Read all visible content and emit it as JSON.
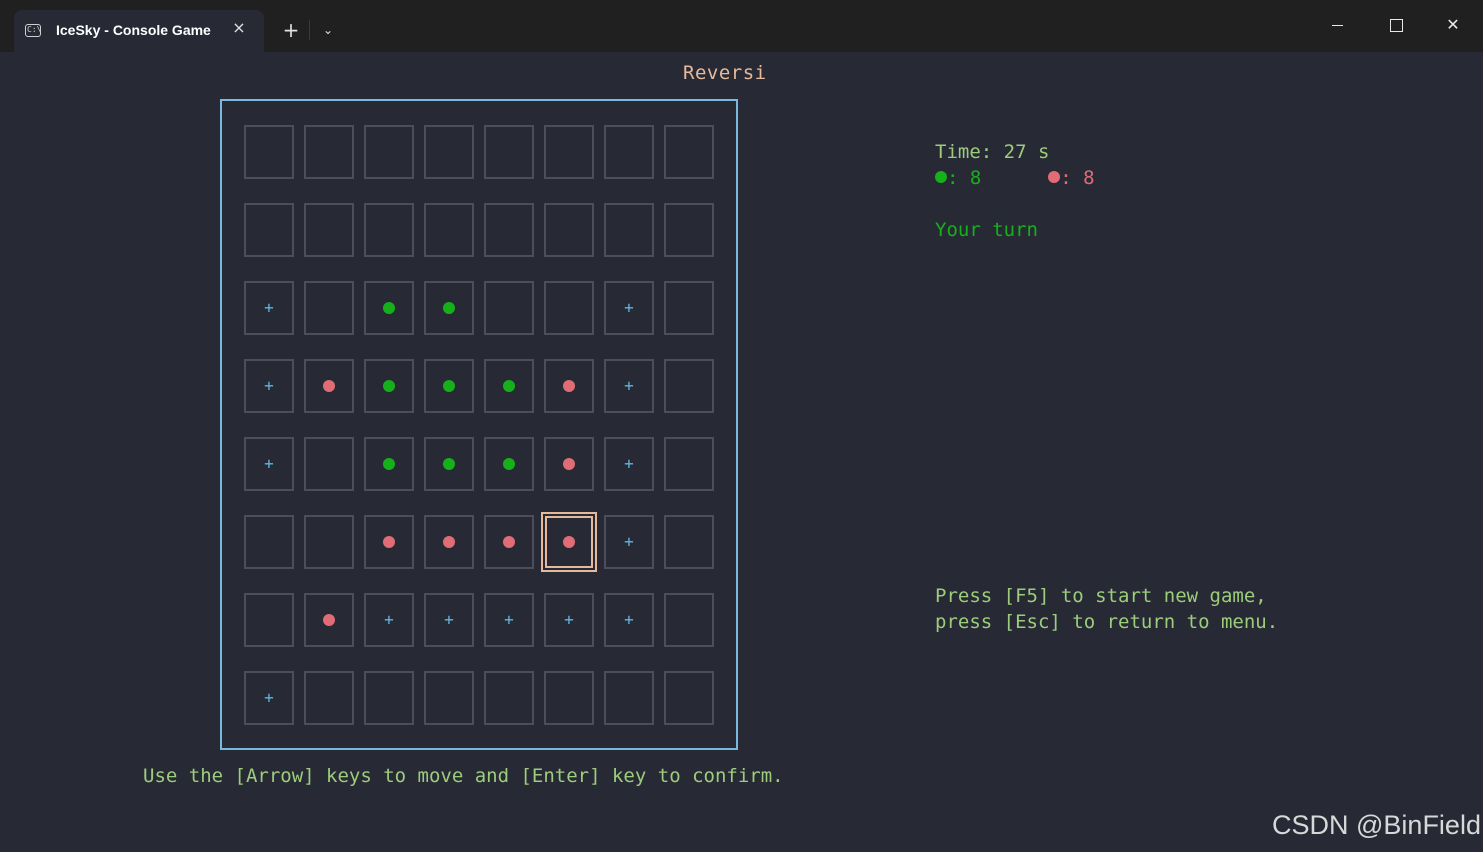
{
  "window": {
    "tab_title": "IceSky - Console Game",
    "tab_icon": "terminal-icon",
    "tab_close": "×",
    "new_tab": "+",
    "dropdown": "⌄"
  },
  "game": {
    "title": "Reversi",
    "time_label": "Time: 27 s",
    "green_score": ": 8",
    "red_score": ": 8",
    "turn_text": "Your turn",
    "help_text": "Press [F5] to start new game,\npress [Esc] to return to menu.",
    "controls_text": "Use the [Arrow] keys to move and [Enter] key to confirm.",
    "selected_cell": [
      5,
      5
    ],
    "board": [
      "........",
      "........",
      "+.GG..+.",
      "+RGGGR+.",
      "+.GGGR+.",
      "..RRRR+.",
      ".R+++++.",
      "+......."
    ]
  },
  "colors": {
    "background": "#272a35",
    "green_piece": "#16b01a",
    "red_piece": "#e06c75",
    "hint": "#61b4e0",
    "board_border": "#79b8e0",
    "cursor": "#e6b99a"
  },
  "watermark": "CSDN @BinField"
}
